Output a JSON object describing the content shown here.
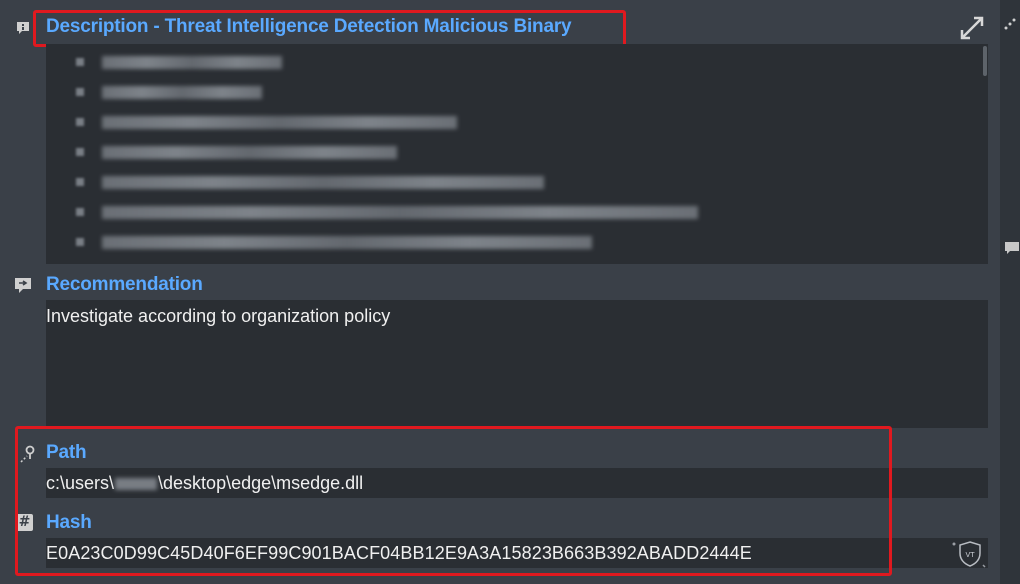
{
  "description": {
    "title": "Description - Threat Intelligence Detection Malicious Binary",
    "icon": "info-icon"
  },
  "recommendation": {
    "title": "Recommendation",
    "text": "Investigate according to organization policy",
    "icon": "recommendation-icon"
  },
  "path": {
    "title": "Path",
    "prefix": "c:\\users\\",
    "suffix": "\\desktop\\edge\\msedge.dll",
    "icon": "path-icon"
  },
  "hash": {
    "title": "Hash",
    "value": "E0A23C0D99C45D40F6EF99C901BACF04BB12E9A3A15823B663B392ABADD2444E",
    "icon": "hash-icon",
    "vt_label": "VT"
  },
  "colors": {
    "accent": "#5aa9ff",
    "highlight": "#e0191f",
    "panel": "#3a4048",
    "field": "#2a2e33"
  }
}
